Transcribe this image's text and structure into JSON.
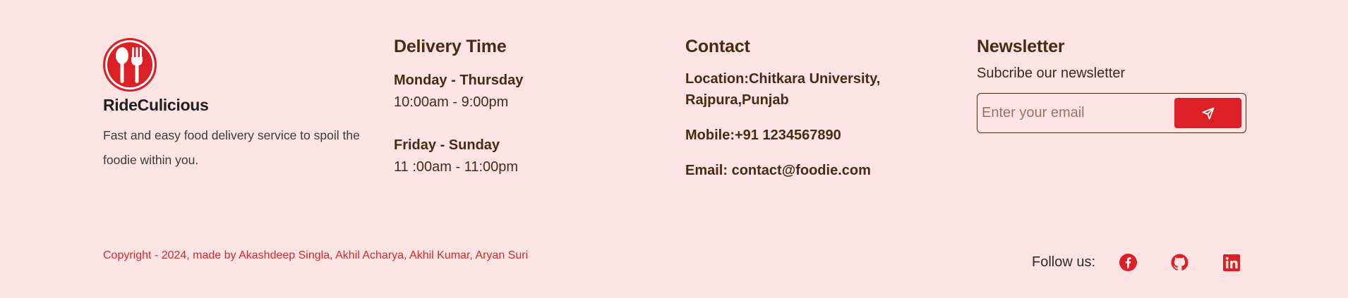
{
  "brand": {
    "name": "RideCulicious",
    "description": "Fast and easy food delivery service to spoil the foodie within you.",
    "logo_icon": "fork-spoon-icon"
  },
  "delivery": {
    "title": "Delivery Time",
    "slots": [
      {
        "days": "Monday - Thursday",
        "hours": "10:00am - 9:00pm"
      },
      {
        "days": "Friday - Sunday",
        "hours": "11 :00am - 11:00pm"
      }
    ]
  },
  "contact": {
    "title": "Contact",
    "location": "Location:Chitkara University, Rajpura,Punjab",
    "mobile": "Mobile:+91 1234567890",
    "email": "Email: contact@foodie.com"
  },
  "newsletter": {
    "title": "Newsletter",
    "subtitle": "Subcribe our newsletter",
    "placeholder": "Enter your email",
    "value": "",
    "send_icon": "send-icon"
  },
  "copyright": "Copyright - 2024, made by Akashdeep Singla, Akhil Acharya, Akhil Kumar, Aryan Suri",
  "follow": {
    "label": "Follow us:",
    "icons": [
      "facebook-icon",
      "github-icon",
      "linkedin-icon"
    ]
  },
  "colors": {
    "background": "#fce4e4",
    "accent": "#dc2026",
    "heading": "#4a2a12"
  }
}
